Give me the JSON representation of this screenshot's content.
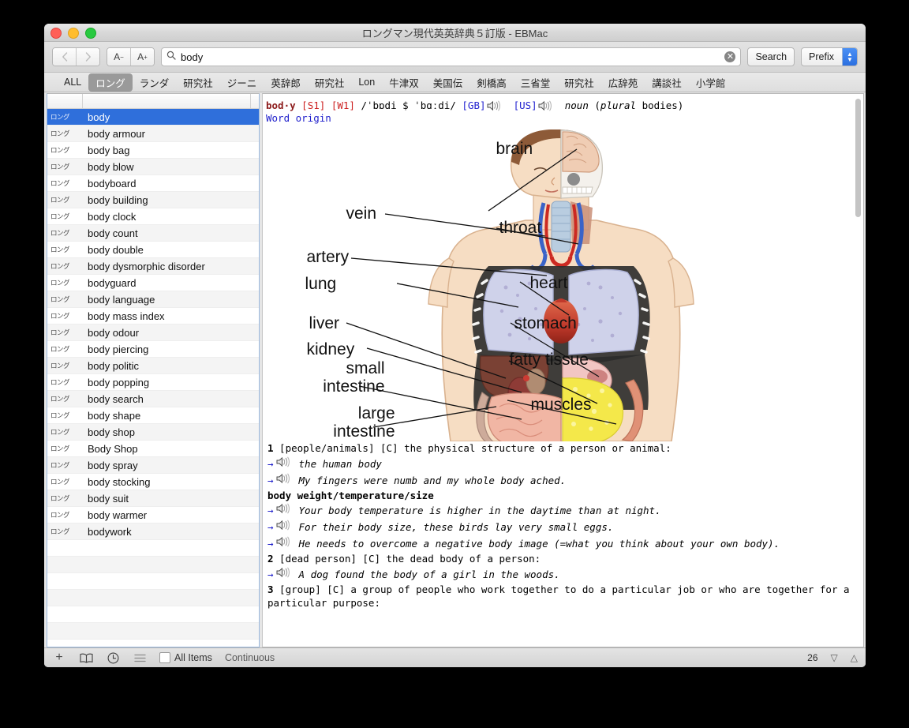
{
  "window": {
    "title": "ロングマン現代英英辞典５訂版 - EBMac"
  },
  "toolbar": {
    "back_label": "‹",
    "forward_label": "›",
    "font_smaller_label": "A",
    "font_smaller_sup": "−",
    "font_larger_label": "A",
    "font_larger_sup": "+",
    "search_value": "body",
    "search_placeholder": "Search",
    "clear_label": "✕",
    "search_button_label": "Search",
    "match_mode_label": "Prefix"
  },
  "tabs": [
    {
      "label": "ALL",
      "active": false
    },
    {
      "label": "ロング",
      "active": true
    },
    {
      "label": "ランダ",
      "active": false
    },
    {
      "label": "研究社",
      "active": false
    },
    {
      "label": "ジーニ",
      "active": false
    },
    {
      "label": "英辞郎",
      "active": false
    },
    {
      "label": "研究社",
      "active": false
    },
    {
      "label": "Lon",
      "active": false
    },
    {
      "label": "牛津双",
      "active": false
    },
    {
      "label": "美国伝",
      "active": false
    },
    {
      "label": "剣橋高",
      "active": false
    },
    {
      "label": "三省堂",
      "active": false
    },
    {
      "label": "研究社",
      "active": false
    },
    {
      "label": "広辞苑",
      "active": false
    },
    {
      "label": "講談社",
      "active": false
    },
    {
      "label": "小学館",
      "active": false
    }
  ],
  "wordlist": {
    "tag": "ロング",
    "items": [
      {
        "word": "body",
        "selected": true
      },
      {
        "word": "body armour",
        "selected": false
      },
      {
        "word": "body bag",
        "selected": false
      },
      {
        "word": "body blow",
        "selected": false
      },
      {
        "word": "bodyboard",
        "selected": false
      },
      {
        "word": "body building",
        "selected": false
      },
      {
        "word": "body clock",
        "selected": false
      },
      {
        "word": "body count",
        "selected": false
      },
      {
        "word": "body double",
        "selected": false
      },
      {
        "word": "body dysmorphic disorder",
        "selected": false
      },
      {
        "word": "bodyguard",
        "selected": false
      },
      {
        "word": "body language",
        "selected": false
      },
      {
        "word": "body mass index",
        "selected": false
      },
      {
        "word": "body odour",
        "selected": false
      },
      {
        "word": "body piercing",
        "selected": false
      },
      {
        "word": "body politic",
        "selected": false
      },
      {
        "word": "body popping",
        "selected": false
      },
      {
        "word": "body search",
        "selected": false
      },
      {
        "word": "body shape",
        "selected": false
      },
      {
        "word": "body shop",
        "selected": false
      },
      {
        "word": "Body Shop",
        "selected": false
      },
      {
        "word": "body spray",
        "selected": false
      },
      {
        "word": "body stocking",
        "selected": false
      },
      {
        "word": "body suit",
        "selected": false
      },
      {
        "word": "body warmer",
        "selected": false
      },
      {
        "word": "bodywork",
        "selected": false
      }
    ]
  },
  "entry": {
    "headword": "bod·y",
    "freq_markers": [
      "[S1]",
      "[W1]"
    ],
    "pronunciation": "/ˈbɒdi $ ˈbɑːdi/",
    "gb_label": "[GB]",
    "us_label": "[US]",
    "part_of_speech": "noun",
    "inflection_open": "(",
    "inflection_plural_label": "plural",
    "inflection_plural": "bodies",
    "inflection_close": ")",
    "word_origin": "Word origin",
    "figure_labels": [
      {
        "text": "brain"
      },
      {
        "text": "vein"
      },
      {
        "text": "throat"
      },
      {
        "text": "artery"
      },
      {
        "text": "lung"
      },
      {
        "text": "heart"
      },
      {
        "text": "liver"
      },
      {
        "text": "stomach"
      },
      {
        "text": "kidney"
      },
      {
        "text": "fatty tissue"
      },
      {
        "text": "small\nintestine"
      },
      {
        "text": "muscles"
      },
      {
        "text": "large\nintestine"
      }
    ],
    "senses": [
      {
        "number": "1",
        "domain": "[people/animals]",
        "grammar": "[C]",
        "text": "the physical structure of a person or animal:",
        "examples": [
          "the human body",
          "My fingers were numb and my whole body ached."
        ],
        "runon": "body weight/temperature/size",
        "runon_examples": [
          "Your body temperature is higher in the daytime than at night.",
          "For their body size, these birds lay very small eggs.",
          "He needs to overcome a negative body image (=what you think about your own body)."
        ]
      },
      {
        "number": "2",
        "domain": "[dead person]",
        "grammar": "[C]",
        "text": "the dead body of a person:",
        "examples": [
          "A dog found the body of a girl in the woods."
        ],
        "runon": "",
        "runon_examples": []
      },
      {
        "number": "3",
        "domain": "[group]",
        "grammar": "[C]",
        "text": "a group of people who work together to do a particular job or who are together for a particular purpose:",
        "examples": [],
        "runon": "",
        "runon_examples": []
      }
    ]
  },
  "statusbar": {
    "add_label": "+",
    "bookmarks_icon": "book-icon",
    "history_icon": "clock-icon",
    "list_icon": "list-icon",
    "all_items_label": "All Items",
    "mode_label": "Continuous",
    "result_count": "26",
    "prev_label": "▽",
    "next_label": "△"
  },
  "colors": {
    "selection_blue": "#2f6fdb",
    "headword_maroon": "#8c1a1a",
    "freq_red": "#cc2020",
    "link_blue": "#2222cc",
    "accent_popup": "#3a7ceb"
  }
}
